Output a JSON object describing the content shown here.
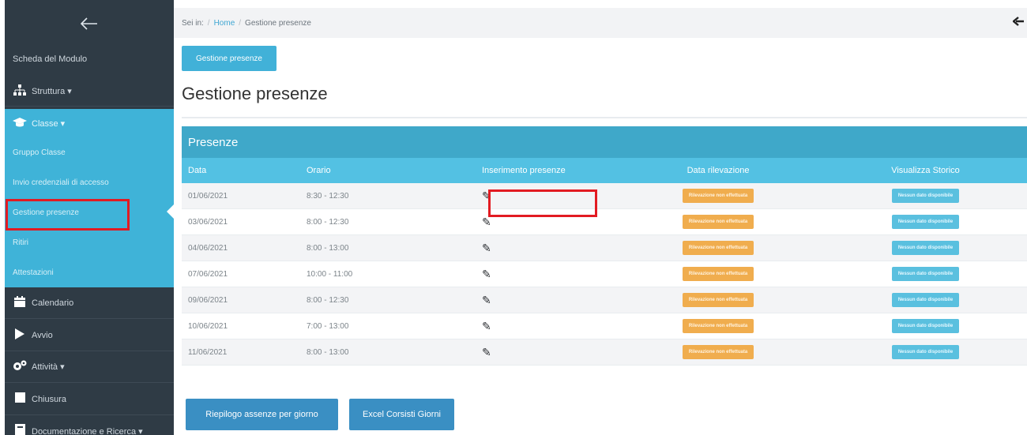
{
  "sidebar": {
    "back_icon": "arrow-left-icon",
    "modulo": "Scheda del Modulo",
    "struttura": "Struttura ▾",
    "classe": "Classe ▾",
    "sub_items": [
      "Gruppo Classe",
      "Invio credenziali di accesso",
      "Gestione presenze",
      "Ritiri",
      "Attestazioni"
    ],
    "calendario": "Calendario",
    "avvio": "Avvio",
    "attivita": "Attività ▾",
    "chiusura": "Chiusura",
    "documentazione": "Documentazione e Ricerca ▾"
  },
  "breadcrumb": {
    "prefix": "Sei in:",
    "home": "Home",
    "current": "Gestione presenze"
  },
  "top_button": "Gestione presenze",
  "page_title": "Gestione presenze",
  "panel_title": "Presenze",
  "columns": [
    "Data",
    "Orario",
    "Inserimento presenze",
    "Data rilevazione",
    "Visualizza Storico"
  ],
  "rows": [
    {
      "data": "01/06/2021",
      "orario": "8:30 - 12:30"
    },
    {
      "data": "03/06/2021",
      "orario": "8:00 - 12:30"
    },
    {
      "data": "04/06/2021",
      "orario": "8:00 - 13:00"
    },
    {
      "data": "07/06/2021",
      "orario": "10:00 - 11:00"
    },
    {
      "data": "09/06/2021",
      "orario": "8:00 - 12:30"
    },
    {
      "data": "10/06/2021",
      "orario": "7:00 - 13:00"
    },
    {
      "data": "11/06/2021",
      "orario": "8:00 - 13:00"
    }
  ],
  "badge_rilevazione": "Rilevazione non effettuata",
  "badge_storico": "Nessun dato disponibile",
  "bottom_buttons": {
    "riepilogo": "Riepilogo assenze per giorno",
    "excel": "Excel Corsisti Giorni"
  },
  "colors": {
    "sidebar": "#2f3b45",
    "accent": "#3fb3d8",
    "highlight": "#e21b22"
  }
}
